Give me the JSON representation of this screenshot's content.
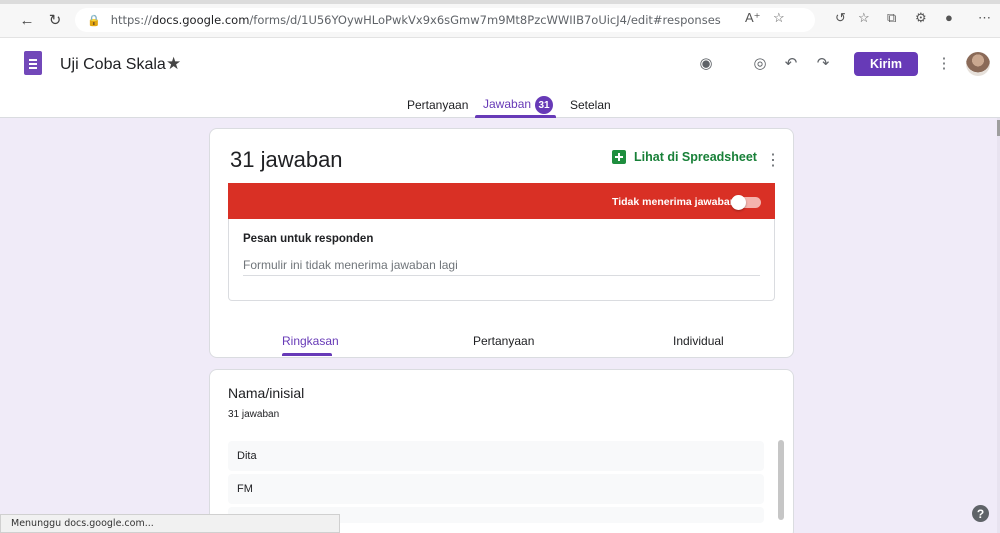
{
  "browser": {
    "url_prefix": "https://",
    "url_host": "docs.google.com",
    "url_path": "/forms/d/1U56YOywHLoPwkVx9x6sGmw7m9Mt8PzcWWIIB7oUicJ4/edit#responses",
    "status_text": "Menunggu docs.google.com..."
  },
  "header": {
    "title": "Uji Coba Skala",
    "send_label": "Kirim"
  },
  "tabs": {
    "questions": "Pertanyaan",
    "responses": "Jawaban",
    "responses_count": "31",
    "settings": "Setelan"
  },
  "responses": {
    "title": "31 jawaban",
    "sheet_link": "Lihat di Spreadsheet",
    "accepting_label": "Tidak menerima jawaban",
    "message_label": "Pesan untuk responden",
    "message_value": "Formulir ini tidak menerima jawaban lagi"
  },
  "subtabs": {
    "summary": "Ringkasan",
    "question": "Pertanyaan",
    "individual": "Individual"
  },
  "question": {
    "title": "Nama/inisial",
    "count": "31 jawaban",
    "answers": [
      "Dita",
      "FM"
    ]
  },
  "colors": {
    "accent": "#673ab7",
    "banner": "#d93025",
    "page_bg": "#f0ebf8",
    "sheets_green": "#188038"
  },
  "icons": {
    "back": "arrow-left-icon",
    "refresh": "refresh-icon",
    "palette": "palette-icon",
    "preview": "eye-icon",
    "undo": "undo-icon",
    "redo": "redo-icon",
    "help": "help-icon"
  }
}
